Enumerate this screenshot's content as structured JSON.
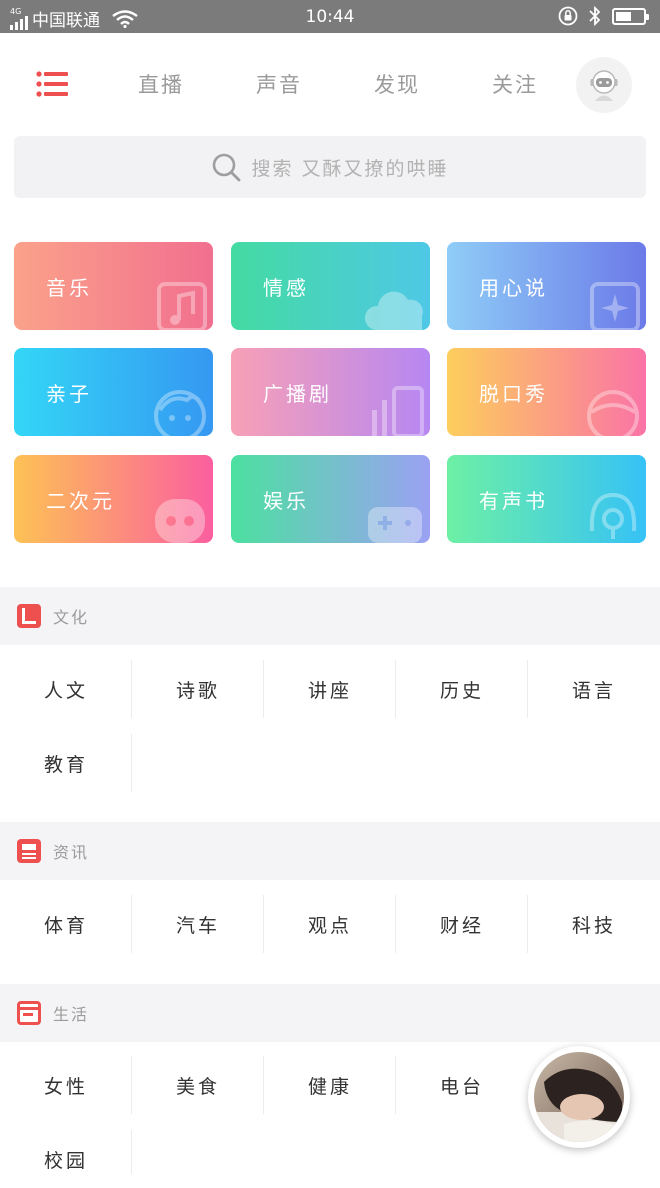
{
  "status_bar": {
    "network": "4G",
    "carrier": "中国联通",
    "time": "10:44",
    "battery_level": 0.58
  },
  "nav": {
    "tabs": [
      {
        "label": "直播"
      },
      {
        "label": "声音"
      },
      {
        "label": "发现"
      },
      {
        "label": "关注"
      }
    ]
  },
  "search": {
    "placeholder": "搜索 又酥又撩的哄睡"
  },
  "categories": [
    {
      "label": "音乐",
      "icon": "music-icon",
      "colors": [
        "#fba28a",
        "#f16f8f"
      ]
    },
    {
      "label": "情感",
      "icon": "cloud-icon",
      "colors": [
        "#44dba2",
        "#4fc8e6"
      ]
    },
    {
      "label": "用心说",
      "icon": "star-icon",
      "colors": [
        "#8fcdf7",
        "#6b7ae8"
      ]
    },
    {
      "label": "亲子",
      "icon": "child-face-icon",
      "colors": [
        "#33d6f6",
        "#3598f2"
      ]
    },
    {
      "label": "广播剧",
      "icon": "soundwave-icon",
      "colors": [
        "#f8a0b6",
        "#b687f2"
      ]
    },
    {
      "label": "脱口秀",
      "icon": "face-icon",
      "colors": [
        "#fcce5c",
        "#fa73a6"
      ]
    },
    {
      "label": "二次元",
      "icon": "robot-icon",
      "colors": [
        "#fdc255",
        "#fb5f9f"
      ]
    },
    {
      "label": "娱乐",
      "icon": "gamepad-icon",
      "colors": [
        "#4ce0a0",
        "#9ba1f3"
      ]
    },
    {
      "label": "有声书",
      "icon": "headphones-icon",
      "colors": [
        "#6df0a5",
        "#36c2f6"
      ]
    }
  ],
  "sections": [
    {
      "title": "文化",
      "items": [
        "人文",
        "诗歌",
        "讲座",
        "历史",
        "语言",
        "教育"
      ]
    },
    {
      "title": "资讯",
      "items": [
        "体育",
        "汽车",
        "观点",
        "财经",
        "科技"
      ]
    },
    {
      "title": "生活",
      "items": [
        "女性",
        "美食",
        "健康",
        "电台",
        "",
        "校园"
      ]
    }
  ],
  "colors": {
    "accent": "#ee4f4f",
    "tab_text": "#9a9a9a",
    "status_bar": "#7b7b7b"
  }
}
